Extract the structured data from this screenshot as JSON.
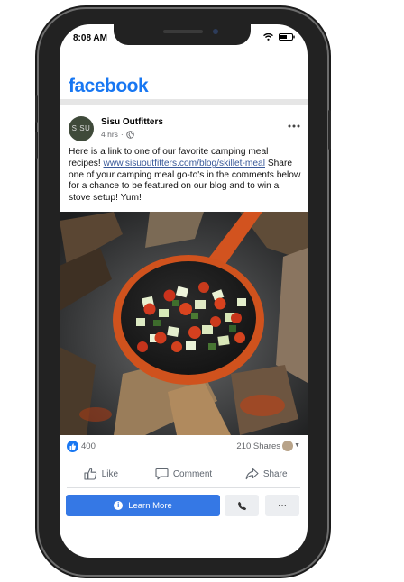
{
  "status_bar": {
    "time": "8:08 AM"
  },
  "app": {
    "brand": "facebook",
    "brand_color": "#1877f2"
  },
  "post": {
    "page_name": "Sisu Outfitters",
    "avatar_text": "SISU",
    "time_ago": "4 hrs",
    "text_intro": "Here is a link to one of our favorite camping meal recipes! ",
    "link": "www.sisuoutfitters.com/blog/skillet-meal",
    "text_body": "Share one of your camping meal go-to's in the comments below for a chance to be featured on our blog and to win a stove setup! Yum!",
    "image_alt": "Vegetables cooking in an orange cast-iron skillet over a campfire"
  },
  "stats": {
    "likes": "400",
    "shares": "210 Shares"
  },
  "actions": {
    "like": "Like",
    "comment": "Comment",
    "share": "Share"
  },
  "cta": {
    "learn_more": "Learn More",
    "more": "···"
  },
  "icons": {
    "globe": "globe-icon",
    "more": "more-horizontal-icon",
    "like": "thumbs-up-icon",
    "comment": "comment-icon",
    "share": "share-icon",
    "phone": "phone-icon",
    "info": "info-icon",
    "wifi": "wifi-icon",
    "battery": "battery-icon"
  }
}
